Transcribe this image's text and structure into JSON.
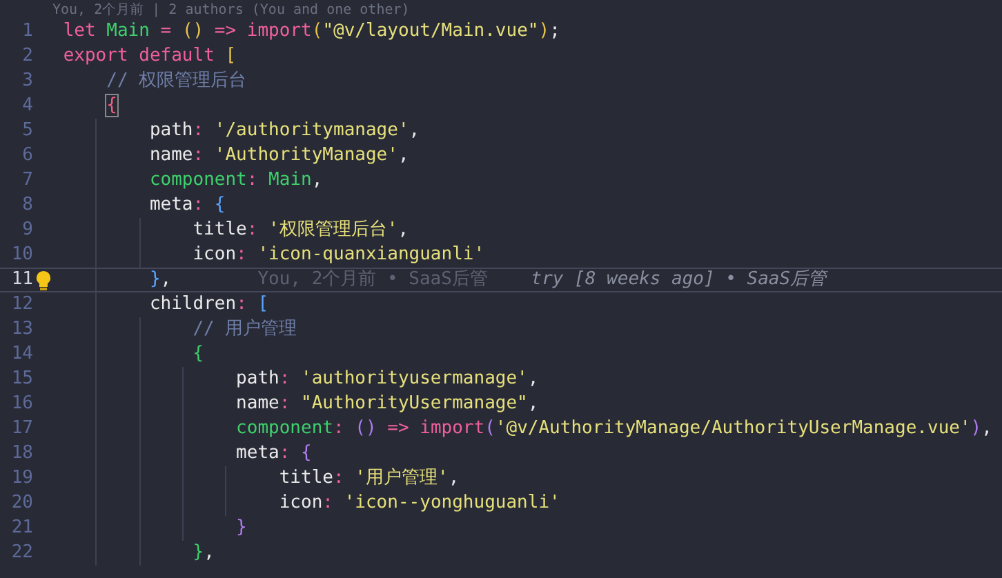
{
  "codelens": "You, 2个月前 | 2 authors (You and one other)",
  "lines": [
    {
      "number": "1",
      "current": false,
      "tokens": [
        {
          "kind": "kw",
          "text": "let "
        },
        {
          "kind": "var",
          "text": "Main"
        },
        {
          "kind": "op",
          "text": " = "
        },
        {
          "kind": "br1",
          "text": "()"
        },
        {
          "kind": "op",
          "text": " => "
        },
        {
          "kind": "kw",
          "text": "import"
        },
        {
          "kind": "br1",
          "text": "("
        },
        {
          "kind": "str",
          "text": "\"@v/layout/Main.vue\""
        },
        {
          "kind": "br1",
          "text": ")"
        },
        {
          "kind": "plain",
          "text": ";"
        }
      ]
    },
    {
      "number": "2",
      "current": false,
      "tokens": [
        {
          "kind": "kw",
          "text": "export default "
        },
        {
          "kind": "br1",
          "text": "["
        }
      ],
      "children": [
        {
          "number": "3",
          "current": false,
          "tokens": [
            {
              "kind": "comment",
              "text": "// 权限管理后台"
            }
          ]
        },
        {
          "number": "4",
          "current": false,
          "tokens": [
            {
              "kind": "match",
              "text": "{"
            }
          ],
          "children": [
            {
              "number": "5",
              "current": false,
              "tokens": [
                {
                  "kind": "prop",
                  "text": "path"
                },
                {
                  "kind": "op",
                  "text": ": "
                },
                {
                  "kind": "str",
                  "text": "'/authoritymanage'"
                },
                {
                  "kind": "plain",
                  "text": ","
                }
              ]
            },
            {
              "number": "6",
              "current": false,
              "tokens": [
                {
                  "kind": "prop",
                  "text": "name"
                },
                {
                  "kind": "op",
                  "text": ": "
                },
                {
                  "kind": "str",
                  "text": "'AuthorityManage'"
                },
                {
                  "kind": "plain",
                  "text": ","
                }
              ]
            },
            {
              "number": "7",
              "current": false,
              "tokens": [
                {
                  "kind": "var",
                  "text": "component"
                },
                {
                  "kind": "op",
                  "text": ": "
                },
                {
                  "kind": "var",
                  "text": "Main"
                },
                {
                  "kind": "plain",
                  "text": ","
                }
              ]
            },
            {
              "number": "8",
              "current": false,
              "tokens": [
                {
                  "kind": "prop",
                  "text": "meta"
                },
                {
                  "kind": "op",
                  "text": ": "
                },
                {
                  "kind": "br3",
                  "text": "{"
                }
              ],
              "children": [
                {
                  "number": "9",
                  "current": false,
                  "tokens": [
                    {
                      "kind": "prop",
                      "text": "title"
                    },
                    {
                      "kind": "op",
                      "text": ": "
                    },
                    {
                      "kind": "str",
                      "text": "'权限管理后台'"
                    },
                    {
                      "kind": "plain",
                      "text": ","
                    }
                  ]
                },
                {
                  "number": "10",
                  "current": false,
                  "tokens": [
                    {
                      "kind": "prop",
                      "text": "icon"
                    },
                    {
                      "kind": "op",
                      "text": ": "
                    },
                    {
                      "kind": "str",
                      "text": "'icon-quanxianguanli'"
                    }
                  ]
                }
              ]
            },
            {
              "number": "11",
              "current": true,
              "blame": "You, 2个月前 • SaaS后管",
              "hover": "try [8 weeks ago] • SaaS后管",
              "tokens": [
                {
                  "kind": "br3",
                  "text": "}"
                },
                {
                  "kind": "plain",
                  "text": ","
                }
              ]
            },
            {
              "number": "12",
              "current": false,
              "tokens": [
                {
                  "kind": "prop",
                  "text": "children"
                },
                {
                  "kind": "op",
                  "text": ": "
                },
                {
                  "kind": "br3",
                  "text": "["
                }
              ],
              "children": [
                {
                  "number": "13",
                  "current": false,
                  "tokens": [
                    {
                      "kind": "comment",
                      "text": "// 用户管理"
                    }
                  ]
                },
                {
                  "number": "14",
                  "current": false,
                  "tokens": [
                    {
                      "kind": "br4",
                      "text": "{"
                    }
                  ],
                  "children": [
                    {
                      "number": "15",
                      "current": false,
                      "tokens": [
                        {
                          "kind": "prop",
                          "text": "path"
                        },
                        {
                          "kind": "op",
                          "text": ": "
                        },
                        {
                          "kind": "str",
                          "text": "'authorityusermanage'"
                        },
                        {
                          "kind": "plain",
                          "text": ","
                        }
                      ]
                    },
                    {
                      "number": "16",
                      "current": false,
                      "tokens": [
                        {
                          "kind": "prop",
                          "text": "name"
                        },
                        {
                          "kind": "op",
                          "text": ": "
                        },
                        {
                          "kind": "str",
                          "text": "\"AuthorityUsermanage\""
                        },
                        {
                          "kind": "plain",
                          "text": ","
                        }
                      ]
                    },
                    {
                      "number": "17",
                      "current": false,
                      "tokens": [
                        {
                          "kind": "var",
                          "text": "component"
                        },
                        {
                          "kind": "op",
                          "text": ": "
                        },
                        {
                          "kind": "br5",
                          "text": "()"
                        },
                        {
                          "kind": "op",
                          "text": " => "
                        },
                        {
                          "kind": "kw",
                          "text": "import"
                        },
                        {
                          "kind": "br5",
                          "text": "("
                        },
                        {
                          "kind": "str",
                          "text": "'@v/AuthorityManage/AuthorityUserManage.vue'"
                        },
                        {
                          "kind": "br5",
                          "text": ")"
                        },
                        {
                          "kind": "plain",
                          "text": ","
                        }
                      ]
                    },
                    {
                      "number": "18",
                      "current": false,
                      "tokens": [
                        {
                          "kind": "prop",
                          "text": "meta"
                        },
                        {
                          "kind": "op",
                          "text": ": "
                        },
                        {
                          "kind": "br5",
                          "text": "{"
                        }
                      ],
                      "children": [
                        {
                          "number": "19",
                          "current": false,
                          "tokens": [
                            {
                              "kind": "prop",
                              "text": "title"
                            },
                            {
                              "kind": "op",
                              "text": ": "
                            },
                            {
                              "kind": "str",
                              "text": "'用户管理'"
                            },
                            {
                              "kind": "plain",
                              "text": ","
                            }
                          ]
                        },
                        {
                          "number": "20",
                          "current": false,
                          "tokens": [
                            {
                              "kind": "prop",
                              "text": "icon"
                            },
                            {
                              "kind": "op",
                              "text": ": "
                            },
                            {
                              "kind": "str",
                              "text": "'icon--yonghuguanli'"
                            }
                          ]
                        }
                      ]
                    },
                    {
                      "number": "21",
                      "current": false,
                      "tokens": [
                        {
                          "kind": "br5",
                          "text": "}"
                        }
                      ]
                    }
                  ]
                },
                {
                  "number": "22",
                  "current": false,
                  "tokens": [
                    {
                      "kind": "br4",
                      "text": "}"
                    },
                    {
                      "kind": "plain",
                      "text": ","
                    }
                  ]
                }
              ]
            }
          ]
        }
      ]
    }
  ]
}
